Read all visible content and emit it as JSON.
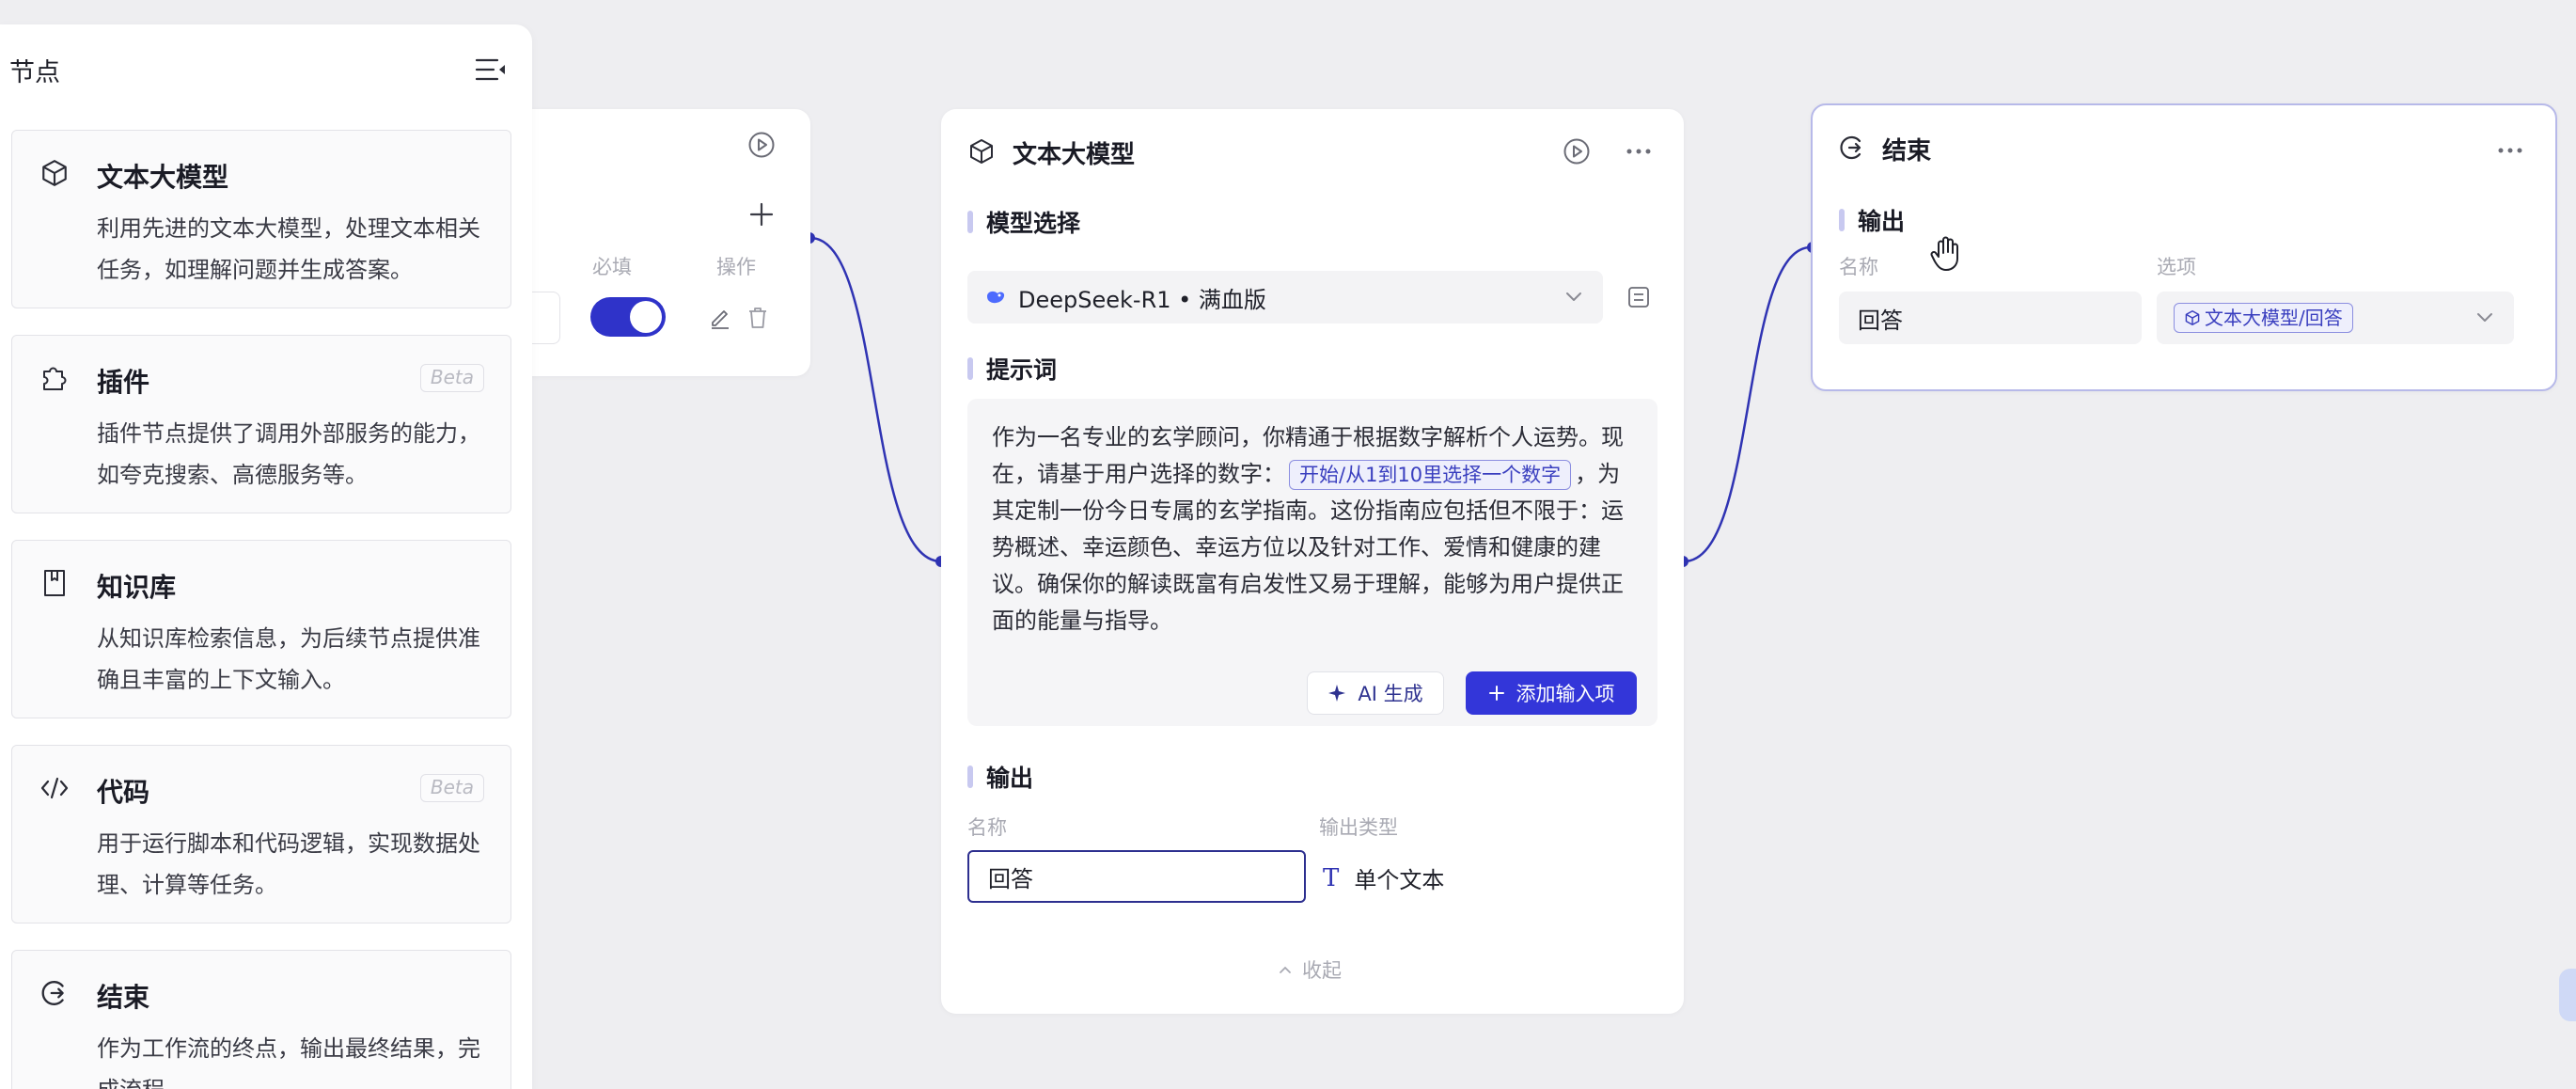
{
  "sidebar": {
    "title": "节点",
    "collapse_icon": "collapse-menu-icon",
    "items": [
      {
        "icon": "cube-icon",
        "title": "文本大模型",
        "desc": "利用先进的文本大模型，处理文本相关任务，如理解问题并生成答案。",
        "badge": ""
      },
      {
        "icon": "puzzle-icon",
        "title": "插件",
        "desc": "插件节点提供了调用外部服务的能力，如夸克搜索、高德服务等。",
        "badge": "Beta"
      },
      {
        "icon": "book-icon",
        "title": "知识库",
        "desc": "从知识库检索信息，为后续节点提供准确且丰富的上下文输入。",
        "badge": ""
      },
      {
        "icon": "code-icon",
        "title": "代码",
        "desc": "用于运行脚本和代码逻辑，实现数据处理、计算等任务。",
        "badge": "Beta"
      },
      {
        "icon": "end-icon",
        "title": "结束",
        "desc": "作为工作流的终点，输出最终结果，完成流程。",
        "badge": ""
      }
    ]
  },
  "start_node": {
    "col_required": "必填",
    "col_action": "操作",
    "required_on": true
  },
  "llm_node": {
    "title": "文本大模型",
    "model_section": "模型选择",
    "model_value": "DeepSeek-R1 • 满血版",
    "prompt_section": "提示词",
    "prompt_part1": "作为一名专业的玄学顾问，你精通于根据数字解析个人运势。现在，请基于用户选择的数字：",
    "prompt_var": "开始/从1到10里选择一个数字",
    "prompt_part2": "，为其定制一份今日专属的玄学指南。这份指南应包括但不限于：运势概述、幸运颜色、幸运方位以及针对工作、爱情和健康的建议。确保你的解读既富有启发性又易于理解，能够为用户提供正面的能量与指导。",
    "ai_button": "AI 生成",
    "add_button": "添加输入项",
    "output_section": "输出",
    "col_name": "名称",
    "col_type": "输出类型",
    "output_name": "回答",
    "output_type": "单个文本",
    "collapse_label": "收起"
  },
  "end_node": {
    "title": "结束",
    "output_section": "输出",
    "col_name": "名称",
    "col_option": "选项",
    "output_name": "回答",
    "output_ref": "文本大模型/回答"
  },
  "colors": {
    "accent": "#3336d9",
    "wire": "#2f33b3",
    "background": "#eeeef1"
  }
}
